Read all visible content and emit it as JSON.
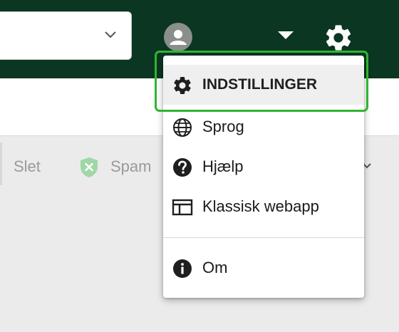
{
  "header": {
    "search_select_value": "",
    "icons": [
      "chevron-down-icon",
      "user-avatar-icon",
      "caret-down-icon",
      "gear-icon"
    ]
  },
  "toolbar": {
    "delete_label": "Slet",
    "spam_label": "Spam"
  },
  "menu": {
    "items": [
      {
        "label": "INDSTILLINGER",
        "icon": "gear-icon"
      },
      {
        "label": "Sprog",
        "icon": "globe-icon"
      },
      {
        "label": "Hjælp",
        "icon": "help-icon"
      },
      {
        "label": "Klassisk webapp",
        "icon": "classic-layout-icon"
      },
      {
        "label": "Om",
        "icon": "info-icon"
      }
    ]
  },
  "colors": {
    "topbar": "#0b3621",
    "highlight": "#2fb52f",
    "shield": "#9fd8a6"
  }
}
